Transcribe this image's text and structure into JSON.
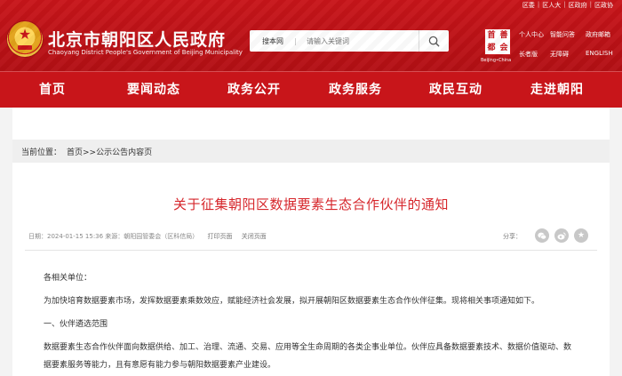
{
  "header": {
    "site_title": "北京市朝阳区人民政府",
    "site_subtitle": "Chaoyang District People's Government of Beijing Municipality",
    "top_links": [
      "区委",
      "区人大",
      "区政府",
      "区政协"
    ],
    "search": {
      "scope": "搜本网",
      "placeholder": "请输入关键词"
    },
    "seal": {
      "chars": [
        "首",
        "善",
        "都",
        "会"
      ],
      "caption": "Beijing•China"
    },
    "quick_links": [
      "个人中心",
      "智能问答",
      "政府邮箱",
      "长者版",
      "无障碍",
      "ENGLISH"
    ]
  },
  "nav": [
    "首页",
    "要闻动态",
    "政务公开",
    "政务服务",
    "政民互动",
    "走进朝阳"
  ],
  "breadcrumb": {
    "label": "当前位置：",
    "path": "首页>>公示公告内容页"
  },
  "article": {
    "title": "关于征集朝阳区数据要素生态合作伙伴的通知",
    "meta": "日期：2024-01-15 15:36  来源：朝阳园管委会（区科信局）",
    "print_label": "打印页面",
    "close_label": "关闭页面",
    "share_label": "分享：",
    "paragraphs": [
      "各相关单位：",
      "为加快培育数据要素市场，发挥数据要素乘数效应，赋能经济社会发展，拟开展朝阳区数据要素生态合作伙伴征集。现将相关事项通知如下。",
      "一、伙伴遴选范围",
      "数据要素生态合作伙伴面向数据供给、加工、治理、流通、交易、应用等全生命周期的各类企事业单位。伙伴应具备数据要素技术、数据价值驱动、数",
      "据要素服务等能力，且有意愿有能力参与朝阳数据要素产业建设。"
    ]
  },
  "colors": {
    "brand_red": "#c8151a",
    "title_red": "#d6262b"
  }
}
